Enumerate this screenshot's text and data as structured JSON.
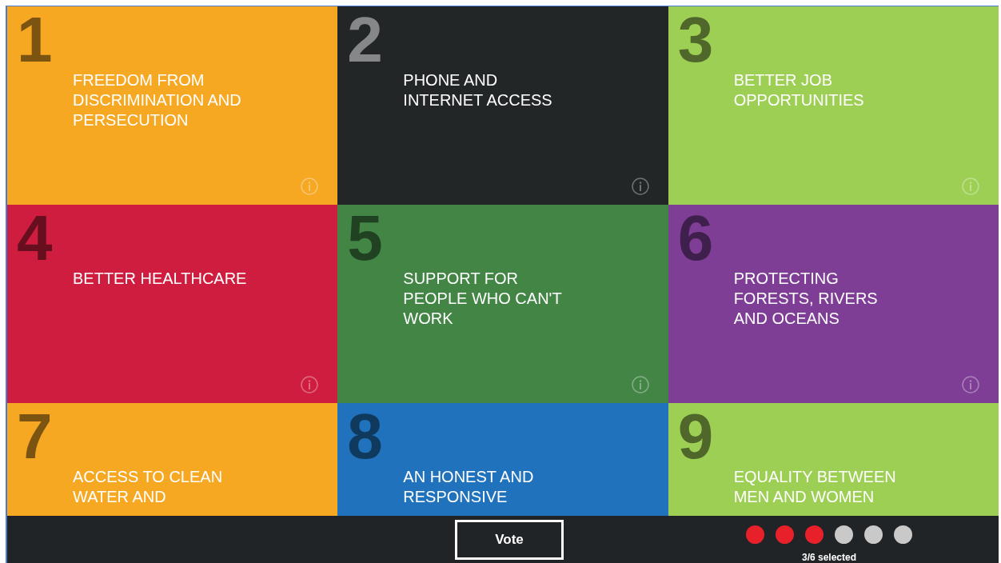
{
  "tiles": [
    {
      "number": "1",
      "title": "FREEDOM FROM\nDISCRIMINATION AND\nPERSECUTION",
      "color": "#f6a823"
    },
    {
      "number": "2",
      "title": "PHONE AND\nINTERNET ACCESS",
      "color": "#222627"
    },
    {
      "number": "3",
      "title": "BETTER JOB\nOPPORTUNITIES",
      "color": "#9ecf55"
    },
    {
      "number": "4",
      "title": "BETTER HEALTHCARE",
      "color": "#cf1d3f"
    },
    {
      "number": "5",
      "title": "SUPPORT FOR\nPEOPLE WHO CAN'T\nWORK",
      "color": "#428545"
    },
    {
      "number": "6",
      "title": "PROTECTING\nFORESTS, RIVERS\nAND OCEANS",
      "color": "#7e3e96"
    },
    {
      "number": "7",
      "title": "ACCESS TO CLEAN\nWATER AND",
      "color": "#f6a823"
    },
    {
      "number": "8",
      "title": "AN HONEST AND\nRESPONSIVE",
      "color": "#1f72bb"
    },
    {
      "number": "9",
      "title": "EQUALITY BETWEEN\nMEN AND WOMEN",
      "color": "#9ecf55"
    }
  ],
  "vote_button": "Vote",
  "selection_dots": [
    {
      "selected": true
    },
    {
      "selected": true
    },
    {
      "selected": true
    },
    {
      "selected": false
    },
    {
      "selected": false
    },
    {
      "selected": false
    }
  ],
  "selection_count": "3/6 selected"
}
